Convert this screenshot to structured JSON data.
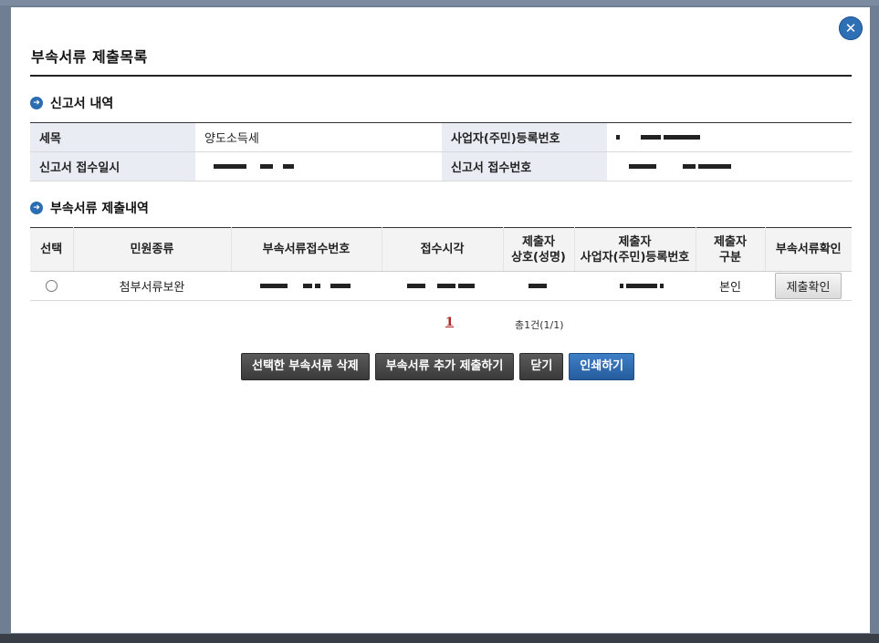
{
  "modal": {
    "title": "부속서류 제출목록",
    "close_icon": "✕"
  },
  "section1": {
    "title": "신고서 내역",
    "labels": {
      "tax_item": "세목",
      "reg_no": "사업자(주민)등록번호",
      "report_date": "신고서 접수일시",
      "report_no": "신고서 접수번호"
    },
    "values": {
      "tax_item": "양도소득세"
    }
  },
  "section2": {
    "title": "부속서류 제출내역",
    "headers": [
      "선택",
      "민원종류",
      "부속서류접수번호",
      "접수시각",
      "제출자\n상호(성명)",
      "제출자\n사업자(주민)등록번호",
      "제출자\n구분",
      "부속서류확인"
    ],
    "rows": [
      {
        "civil_type": "첨부서류보완",
        "submitter_type": "본인",
        "confirm_label": "제출확인"
      }
    ]
  },
  "pagination": {
    "current": "1",
    "total_text": "총1건(1/1)"
  },
  "buttons": {
    "delete": "선택한 부속서류 삭제",
    "add": "부속서류 추가 제출하기",
    "close": "닫기",
    "print": "인쇄하기"
  },
  "colors": {
    "accent": "#2f6fb4",
    "header_bg": "#e9ecf3",
    "dark_button": "#3a3a3a"
  }
}
